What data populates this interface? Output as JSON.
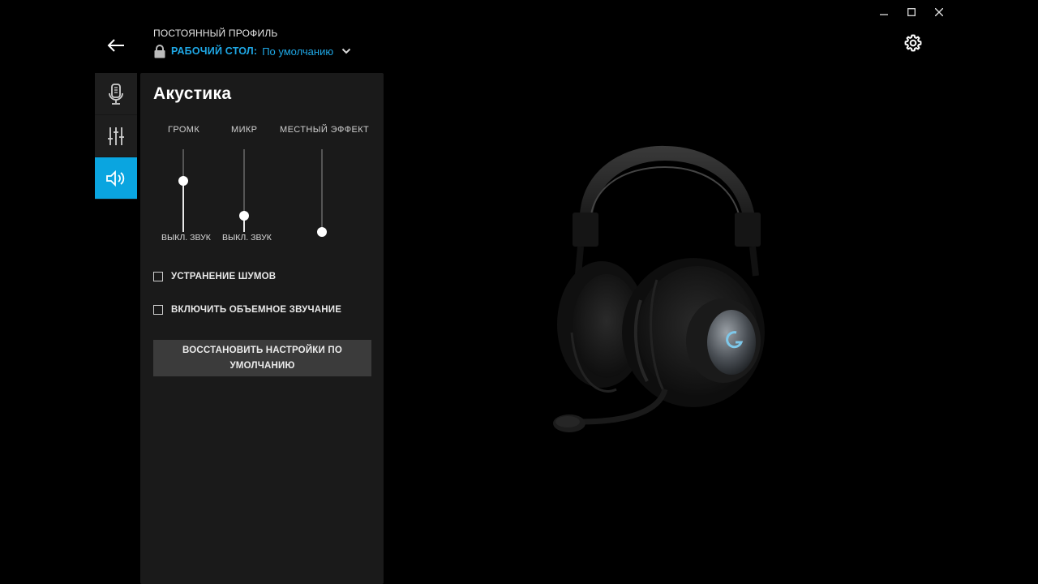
{
  "window": {
    "minimize_icon": "minimize-icon",
    "maximize_icon": "maximize-icon",
    "close_icon": "close-icon"
  },
  "header": {
    "profile_label": "ПОСТОЯННЫЙ ПРОФИЛЬ",
    "profile_app": "РАБОЧИЙ СТОЛ:",
    "profile_name": "По умолчанию"
  },
  "rail": {
    "items": [
      {
        "icon": "microphone-icon",
        "active": false
      },
      {
        "icon": "equalizer-icon",
        "active": false
      },
      {
        "icon": "speaker-icon",
        "active": true
      }
    ]
  },
  "panel": {
    "title": "Акустика",
    "sliders": [
      {
        "label": "ГРОМК",
        "muted_label": "ВЫКЛ. ЗВУК",
        "level": 0.62
      },
      {
        "label": "МИКР",
        "muted_label": "ВЫКЛ. ЗВУК",
        "level": 0.2
      },
      {
        "label": "МЕСТНЫЙ ЭФФЕКТ",
        "muted_label": "",
        "level": 0.0
      }
    ],
    "checkboxes": [
      {
        "label": "УСТРАНЕНИЕ ШУМОВ",
        "checked": false
      },
      {
        "label": "ВКЛЮЧИТЬ ОБЪЕМНОЕ ЗВУЧАНИЕ",
        "checked": false
      }
    ],
    "reset_label": "ВОССТАНОВИТЬ НАСТРОЙКИ ПО УМОЛЧАНИЮ"
  },
  "colors": {
    "accent": "#0aa5e0",
    "link": "#1fa8e6",
    "panel_bg": "#1a1a1a",
    "rail_bg": "#1e1e1e",
    "button_bg": "#3b3b3b"
  }
}
